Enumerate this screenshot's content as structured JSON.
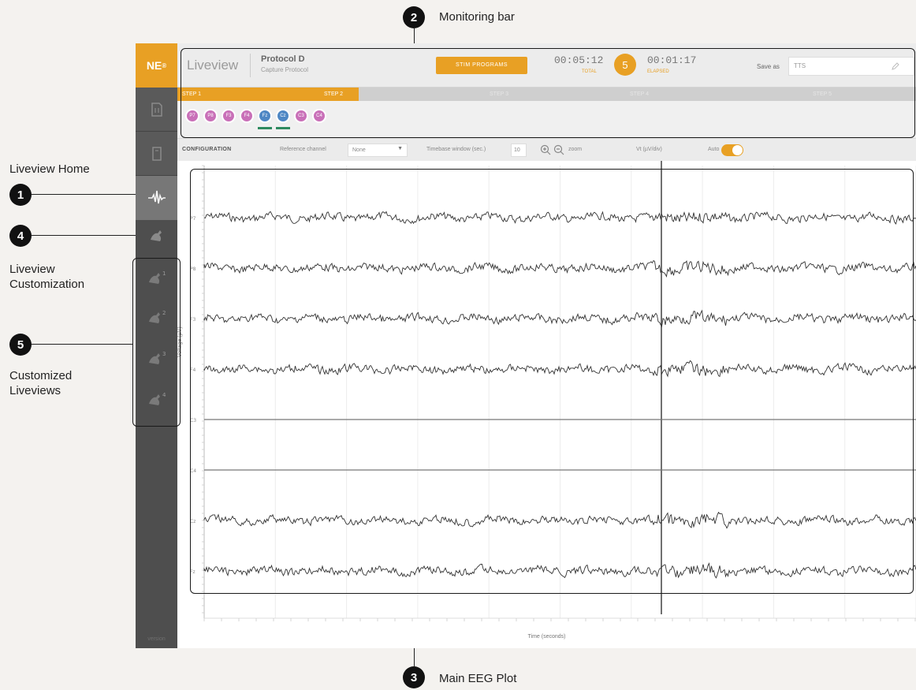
{
  "callouts": {
    "monitoring_bar": {
      "num": "2",
      "label": "Monitoring bar"
    },
    "main_eeg_plot": {
      "num": "3",
      "label": "Main EEG Plot"
    },
    "liveview_home": {
      "num": "1",
      "label": "Liveview Home"
    },
    "liveview_customization": {
      "num": "4",
      "label_line1": "Liveview",
      "label_line2": "Customization"
    },
    "customized_liveviews": {
      "num": "5",
      "label_line1": "Customized",
      "label_line2": "Liveviews"
    }
  },
  "app": {
    "logo": "NE",
    "logo_sup": "®",
    "title": "Liveview",
    "protocol_name": "Protocol D",
    "protocol_sub": "Capture Protocol",
    "stim_button": "STIM PROGRAMS",
    "timer_total": "00:05:12",
    "timer_total_sub": "TOTAL",
    "step_number": "5",
    "timer_step": "00:01:17",
    "timer_step_sub": "ELAPSED",
    "save_label": "Save as",
    "save_value": "TTS",
    "tabs": [
      "STEP 1",
      "STEP 2",
      "STEP 3",
      "STEP 4",
      "STEP 5"
    ],
    "channels": [
      {
        "label": "P7",
        "color": "pink"
      },
      {
        "label": "P8",
        "color": "pink"
      },
      {
        "label": "F3",
        "color": "pink"
      },
      {
        "label": "F4",
        "color": "pink"
      },
      {
        "label": "Fz",
        "color": "blue",
        "active": true
      },
      {
        "label": "Cz",
        "color": "blue",
        "active": true
      },
      {
        "label": "C3",
        "color": "pink"
      },
      {
        "label": "C4",
        "color": "pink"
      }
    ],
    "config": {
      "title": "CONFIGURATION",
      "ref_label": "Reference channel",
      "ref_value": "None",
      "window_label": "Timebase window (sec.)",
      "window_value": "10",
      "zoom_label": "zoom",
      "scale_label": "Vt (µV/div)",
      "auto_label": "Auto"
    },
    "plot": {
      "xlabel": "Time (seconds)",
      "ylabel": "Voltage (µV)",
      "channels": [
        "P7",
        "P8",
        "F3",
        "F4",
        "C3",
        "C4",
        "Cz",
        "Fz"
      ],
      "flat_channels": [
        4,
        5
      ]
    },
    "sidebar_footer": "version"
  },
  "colors": {
    "accent": "#e8a024",
    "sidebar": "#4e4e4e",
    "trace": "#333333"
  },
  "icons": [
    "neuro-logo-icon",
    "home-icon",
    "protocol-icon",
    "eeg-wave-icon",
    "customize-icon",
    "custom-liveview-icon",
    "pencil-icon",
    "zoom-in-icon",
    "zoom-out-icon"
  ]
}
